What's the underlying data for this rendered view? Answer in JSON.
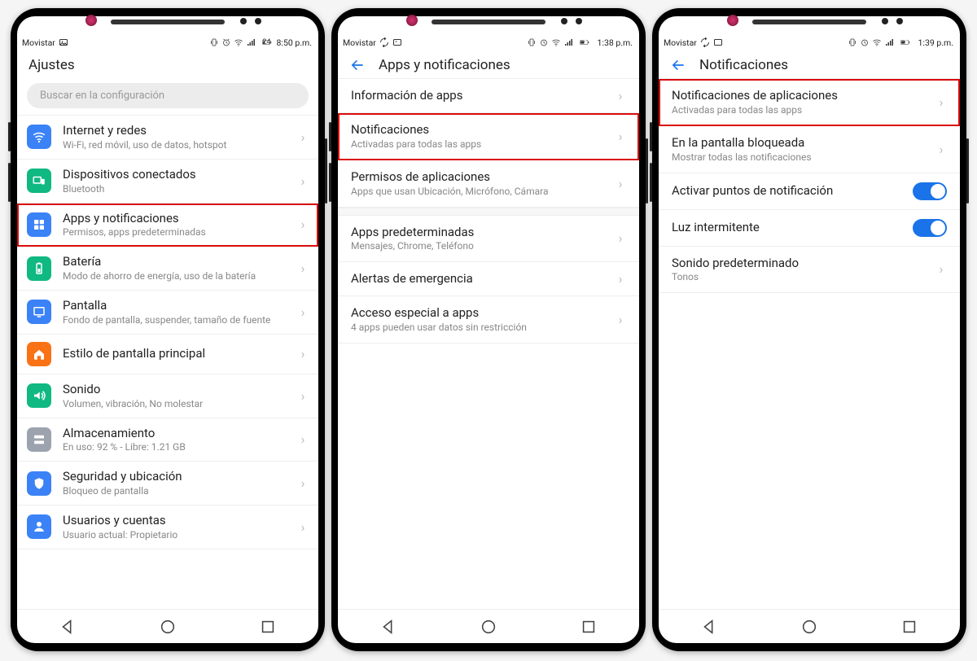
{
  "phone1": {
    "status": {
      "carrier": "Movistar",
      "battery": "24",
      "time": "8:50 p.m."
    },
    "header": "Ajustes",
    "search_placeholder": "Buscar en la configuración",
    "items": [
      {
        "title": "Internet y redes",
        "sub": "Wi-Fi, red móvil, uso de datos, hotspot",
        "icon": "wifi",
        "color": "#3b82f6"
      },
      {
        "title": "Dispositivos conectados",
        "sub": "Bluetooth",
        "icon": "devices",
        "color": "#10b981"
      },
      {
        "title": "Apps y notificaciones",
        "sub": "Permisos, apps predeterminadas",
        "icon": "apps",
        "color": "#3b82f6",
        "highlight": true
      },
      {
        "title": "Batería",
        "sub": "Modo de ahorro de energía, uso de la batería",
        "icon": "battery",
        "color": "#10b981"
      },
      {
        "title": "Pantalla",
        "sub": "Fondo de pantalla, suspender, tamaño de fuente",
        "icon": "display",
        "color": "#3b82f6"
      },
      {
        "title": "Estilo de pantalla principal",
        "sub": "",
        "icon": "home",
        "color": "#f97316"
      },
      {
        "title": "Sonido",
        "sub": "Volumen, vibración, No molestar",
        "icon": "sound",
        "color": "#10b981"
      },
      {
        "title": "Almacenamiento",
        "sub": "En uso: 92 % - Libre: 1.21 GB",
        "icon": "storage",
        "color": "#9ca3af"
      },
      {
        "title": "Seguridad y ubicación",
        "sub": "Bloqueo de pantalla",
        "icon": "security",
        "color": "#3b82f6"
      },
      {
        "title": "Usuarios y cuentas",
        "sub": "Usuario actual: Propietario",
        "icon": "user",
        "color": "#3b82f6"
      }
    ]
  },
  "phone2": {
    "status": {
      "carrier": "Movistar",
      "battery": "51",
      "time": "1:38 p.m."
    },
    "header": "Apps y notificaciones",
    "groups": [
      [
        {
          "title": "Información de apps",
          "sub": ""
        },
        {
          "title": "Notificaciones",
          "sub": "Activadas para todas las apps",
          "highlight": true
        },
        {
          "title": "Permisos de aplicaciones",
          "sub": "Apps que usan Ubicación, Micrófono, Cámara"
        }
      ],
      [
        {
          "title": "Apps predeterminadas",
          "sub": "Mensajes, Chrome, Teléfono"
        },
        {
          "title": "Alertas de emergencia",
          "sub": ""
        },
        {
          "title": "Acceso especial a apps",
          "sub": "4 apps pueden usar datos sin restricción"
        }
      ]
    ]
  },
  "phone3": {
    "status": {
      "carrier": "Movistar",
      "battery": "51",
      "time": "1:39 p.m."
    },
    "header": "Notificaciones",
    "items": [
      {
        "title": "Notificaciones de aplicaciones",
        "sub": "Activadas para todas las apps",
        "highlight": true,
        "type": "link"
      },
      {
        "title": "En la pantalla bloqueada",
        "sub": "Mostrar todas las notificaciones",
        "type": "link"
      },
      {
        "title": "Activar puntos de notificación",
        "type": "toggle",
        "on": true
      },
      {
        "title": "Luz intermitente",
        "type": "toggle",
        "on": true
      },
      {
        "title": "Sonido predeterminado",
        "sub": "Tonos",
        "type": "link"
      }
    ]
  }
}
